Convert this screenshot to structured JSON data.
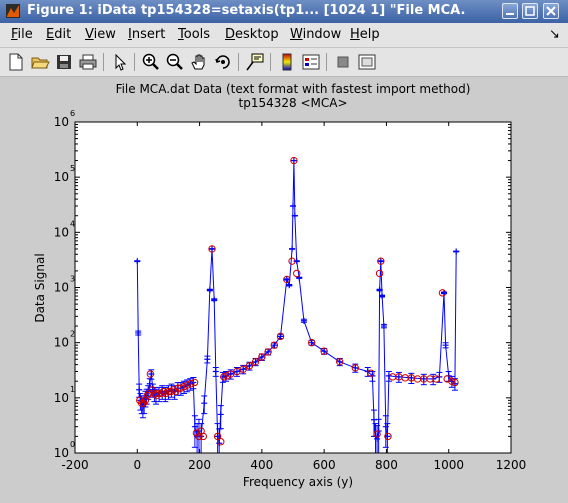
{
  "window": {
    "title": "Figure 1: iData tp154328=setaxis(tp1... [1024     1] \"File MCA.",
    "icon": "matlab-figure-icon"
  },
  "menu": {
    "items": [
      {
        "label": "File",
        "accel": "F"
      },
      {
        "label": "Edit",
        "accel": "E"
      },
      {
        "label": "View",
        "accel": "V"
      },
      {
        "label": "Insert",
        "accel": "I"
      },
      {
        "label": "Tools",
        "accel": "T"
      },
      {
        "label": "Desktop",
        "accel": "D"
      },
      {
        "label": "Window",
        "accel": "W"
      },
      {
        "label": "Help",
        "accel": "H"
      }
    ],
    "dock_arrow": "↘"
  },
  "toolbar": {
    "icons": [
      "new-file-icon",
      "open-file-icon",
      "save-icon",
      "print-icon",
      "pointer-icon",
      "zoom-in-icon",
      "zoom-out-icon",
      "pan-hand-icon",
      "rotate-3d-icon",
      "data-cursor-icon",
      "colorbar-icon",
      "legend-icon",
      "hide-plot-tools-icon",
      "show-plot-tools-icon"
    ]
  },
  "chart_data": {
    "type": "scatter",
    "title": "File MCA.dat Data (text format with fastest import method)",
    "subtitle": "tp154328 <MCA>",
    "xlabel": "Frequency axis (y)",
    "ylabel": "Data Signal",
    "xlim": [
      -200,
      1200
    ],
    "ylim": [
      1,
      1000000
    ],
    "yscale": "log",
    "xticks": [
      "-200",
      "0",
      "200",
      "400",
      "600",
      "800",
      "1000",
      "1200"
    ],
    "yticks": [
      {
        "base": "10",
        "exp": "0"
      },
      {
        "base": "10",
        "exp": "1"
      },
      {
        "base": "10",
        "exp": "2"
      },
      {
        "base": "10",
        "exp": "3"
      },
      {
        "base": "10",
        "exp": "4"
      },
      {
        "base": "10",
        "exp": "5"
      },
      {
        "base": "10",
        "exp": "6"
      }
    ],
    "grid": false,
    "colors": {
      "line": "#0000ff",
      "markers": "#cc0000"
    },
    "series": [
      {
        "points": [
          [
            0,
            3000
          ],
          [
            3,
            150
          ],
          [
            6,
            14
          ],
          [
            10,
            9
          ],
          [
            14,
            8
          ],
          [
            18,
            7
          ],
          [
            22,
            8
          ],
          [
            26,
            10
          ],
          [
            30,
            11
          ],
          [
            35,
            13
          ],
          [
            40,
            18
          ],
          [
            45,
            27
          ],
          [
            50,
            14
          ],
          [
            55,
            12
          ],
          [
            60,
            11
          ],
          [
            70,
            12
          ],
          [
            80,
            13
          ],
          [
            90,
            12
          ],
          [
            100,
            13
          ],
          [
            110,
            14
          ],
          [
            120,
            13
          ],
          [
            130,
            15
          ],
          [
            140,
            15
          ],
          [
            150,
            16
          ],
          [
            160,
            17
          ],
          [
            170,
            18
          ],
          [
            180,
            19
          ],
          [
            185,
            3
          ],
          [
            192,
            2
          ],
          [
            198,
            2.5
          ],
          [
            205,
            2
          ],
          [
            215,
            8
          ],
          [
            225,
            50
          ],
          [
            233,
            900
          ],
          [
            240,
            5000
          ],
          [
            247,
            600
          ],
          [
            252,
            30
          ],
          [
            258,
            2
          ],
          [
            263,
            1.5
          ],
          [
            268,
            5
          ],
          [
            275,
            24
          ],
          [
            285,
            25
          ],
          [
            300,
            27
          ],
          [
            320,
            30
          ],
          [
            340,
            33
          ],
          [
            360,
            38
          ],
          [
            380,
            45
          ],
          [
            400,
            55
          ],
          [
            420,
            68
          ],
          [
            440,
            90
          ],
          [
            460,
            130
          ],
          [
            480,
            1400
          ],
          [
            488,
            1100
          ],
          [
            497,
            5000
          ],
          [
            500,
            30000
          ],
          [
            503,
            200000
          ],
          [
            506,
            20000
          ],
          [
            512,
            3000
          ],
          [
            520,
            1500
          ],
          [
            535,
            250
          ],
          [
            560,
            100
          ],
          [
            600,
            70
          ],
          [
            650,
            45
          ],
          [
            700,
            35
          ],
          [
            740,
            30
          ],
          [
            755,
            25
          ],
          [
            760,
            4
          ],
          [
            765,
            2
          ],
          [
            770,
            1.8
          ],
          [
            775,
            2.5
          ],
          [
            778,
            900
          ],
          [
            782,
            3000
          ],
          [
            786,
            700
          ],
          [
            792,
            200
          ],
          [
            798,
            3
          ],
          [
            803,
            2
          ],
          [
            808,
            25
          ],
          [
            840,
            24
          ],
          [
            880,
            23
          ],
          [
            920,
            22
          ],
          [
            950,
            22
          ],
          [
            970,
            24
          ],
          [
            985,
            800
          ],
          [
            990,
            90
          ],
          [
            1000,
            25
          ],
          [
            1010,
            20
          ],
          [
            1020,
            18
          ],
          [
            1024,
            4500
          ]
        ],
        "markers": [
          [
            8,
            9
          ],
          [
            14,
            8
          ],
          [
            20,
            8
          ],
          [
            26,
            9
          ],
          [
            32,
            11
          ],
          [
            38,
            12
          ],
          [
            42,
            27
          ],
          [
            48,
            14
          ],
          [
            55,
            12
          ],
          [
            62,
            11
          ],
          [
            68,
            12
          ],
          [
            76,
            12
          ],
          [
            84,
            13
          ],
          [
            92,
            12
          ],
          [
            100,
            13
          ],
          [
            108,
            13
          ],
          [
            116,
            14
          ],
          [
            124,
            13
          ],
          [
            132,
            15
          ],
          [
            140,
            15
          ],
          [
            150,
            16
          ],
          [
            160,
            17
          ],
          [
            172,
            18
          ],
          [
            184,
            19
          ],
          [
            190,
            2.3
          ],
          [
            198,
            2
          ],
          [
            205,
            2.5
          ],
          [
            212,
            2
          ],
          [
            240,
            5000
          ],
          [
            258,
            2
          ],
          [
            268,
            1.6
          ],
          [
            278,
            24
          ],
          [
            288,
            25
          ],
          [
            300,
            27
          ],
          [
            320,
            30
          ],
          [
            340,
            33
          ],
          [
            360,
            38
          ],
          [
            380,
            45
          ],
          [
            400,
            55
          ],
          [
            420,
            68
          ],
          [
            440,
            90
          ],
          [
            460,
            130
          ],
          [
            480,
            1400
          ],
          [
            497,
            3000
          ],
          [
            503,
            200000
          ],
          [
            512,
            1800
          ],
          [
            560,
            100
          ],
          [
            600,
            70
          ],
          [
            650,
            45
          ],
          [
            700,
            35
          ],
          [
            750,
            28
          ],
          [
            770,
            2.2
          ],
          [
            778,
            1800
          ],
          [
            782,
            3000
          ],
          [
            805,
            2
          ],
          [
            820,
            24
          ],
          [
            840,
            24
          ],
          [
            860,
            23
          ],
          [
            880,
            23
          ],
          [
            900,
            22
          ],
          [
            920,
            22
          ],
          [
            940,
            22
          ],
          [
            960,
            22
          ],
          [
            980,
            800
          ],
          [
            995,
            22
          ],
          [
            1010,
            20
          ],
          [
            1020,
            19
          ]
        ]
      }
    ]
  }
}
